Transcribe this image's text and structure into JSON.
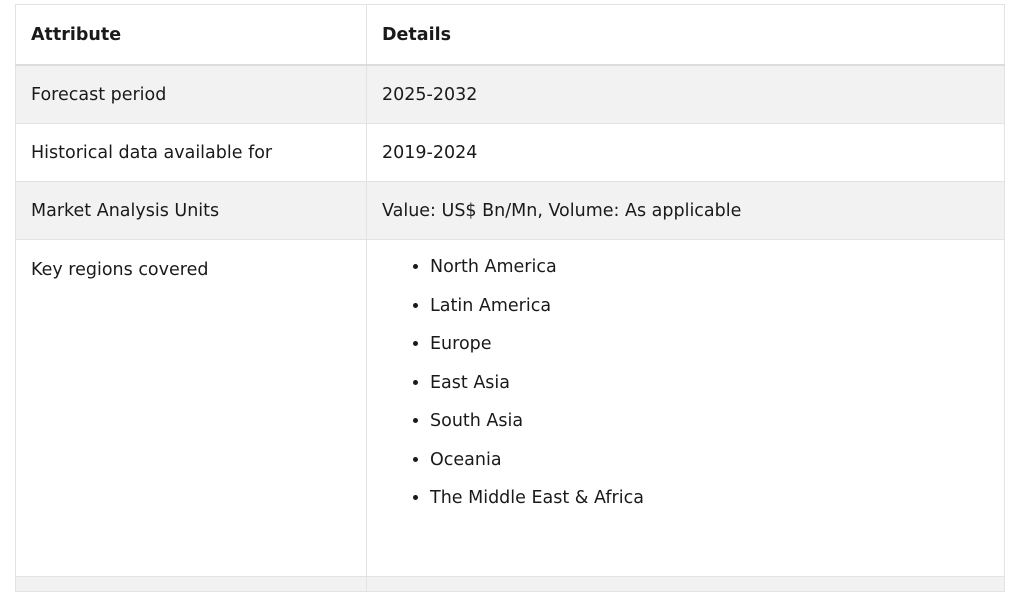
{
  "table": {
    "headers": [
      "Attribute",
      "Details"
    ],
    "rows": [
      {
        "attribute": "Forecast period",
        "details": "2025-2032"
      },
      {
        "attribute": "Historical data available for",
        "details": "2019-2024"
      },
      {
        "attribute": "Market Analysis Units",
        "details": "Value: US$ Bn/Mn, Volume: As applicable"
      }
    ],
    "regions": {
      "attribute": "Key regions covered",
      "items": [
        "North America",
        "Latin America",
        "Europe",
        "East Asia",
        "South Asia",
        "Oceania",
        "The Middle East & Africa"
      ]
    }
  }
}
